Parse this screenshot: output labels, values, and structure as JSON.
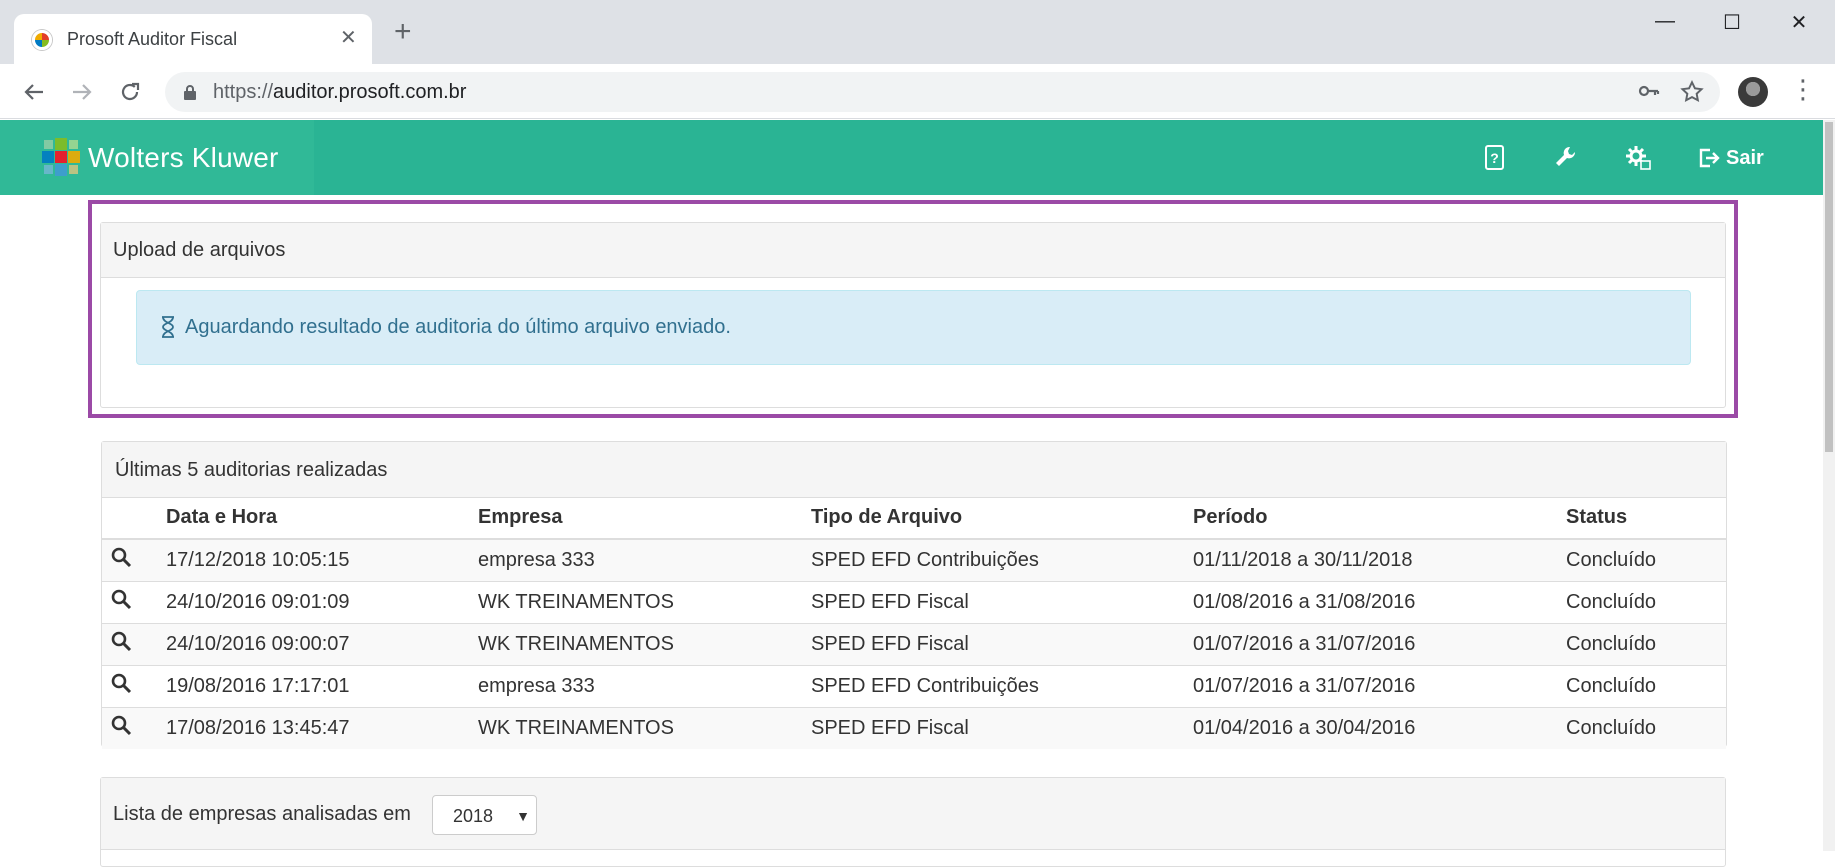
{
  "browser": {
    "tab_title": "Prosoft Auditor Fiscal",
    "tab_close": "✕",
    "new_tab": "+",
    "url_scheme": "https://",
    "url_host": "auditor.prosoft.com.br",
    "win_minimize": "—",
    "win_maximize": "☐",
    "win_close": "✕"
  },
  "header": {
    "brand": "Wolters Kluwer",
    "logout_label": "Sair",
    "brand_color": "#2ab494"
  },
  "upload_panel": {
    "title": "Upload de arquivos",
    "status_message": "Aguardando resultado de auditoria do último arquivo enviado."
  },
  "audits_panel": {
    "title": "Últimas 5 auditorias realizadas",
    "columns": [
      "Data e Hora",
      "Empresa",
      "Tipo de Arquivo",
      "Período",
      "Status"
    ],
    "rows": [
      {
        "datetime": "17/12/2018 10:05:15",
        "empresa": "empresa 333",
        "tipo": "SPED EFD Contribuições",
        "periodo": "01/11/2018 a 30/11/2018",
        "status": "Concluído"
      },
      {
        "datetime": "24/10/2016 09:01:09",
        "empresa": "WK TREINAMENTOS",
        "tipo": "SPED EFD Fiscal",
        "periodo": "01/08/2016 a 31/08/2016",
        "status": "Concluído"
      },
      {
        "datetime": "24/10/2016 09:00:07",
        "empresa": "WK TREINAMENTOS",
        "tipo": "SPED EFD Fiscal",
        "periodo": "01/07/2016 a 31/07/2016",
        "status": "Concluído"
      },
      {
        "datetime": "19/08/2016 17:17:01",
        "empresa": "empresa 333",
        "tipo": "SPED EFD Contribuições",
        "periodo": "01/07/2016 a 31/07/2016",
        "status": "Concluído"
      },
      {
        "datetime": "17/08/2016 13:45:47",
        "empresa": "WK TREINAMENTOS",
        "tipo": "SPED EFD Fiscal",
        "periodo": "01/04/2016 a 30/04/2016",
        "status": "Concluído"
      }
    ]
  },
  "companies_panel": {
    "title": "Lista de empresas analisadas em",
    "year_selected": "2018",
    "caret": "▼"
  }
}
